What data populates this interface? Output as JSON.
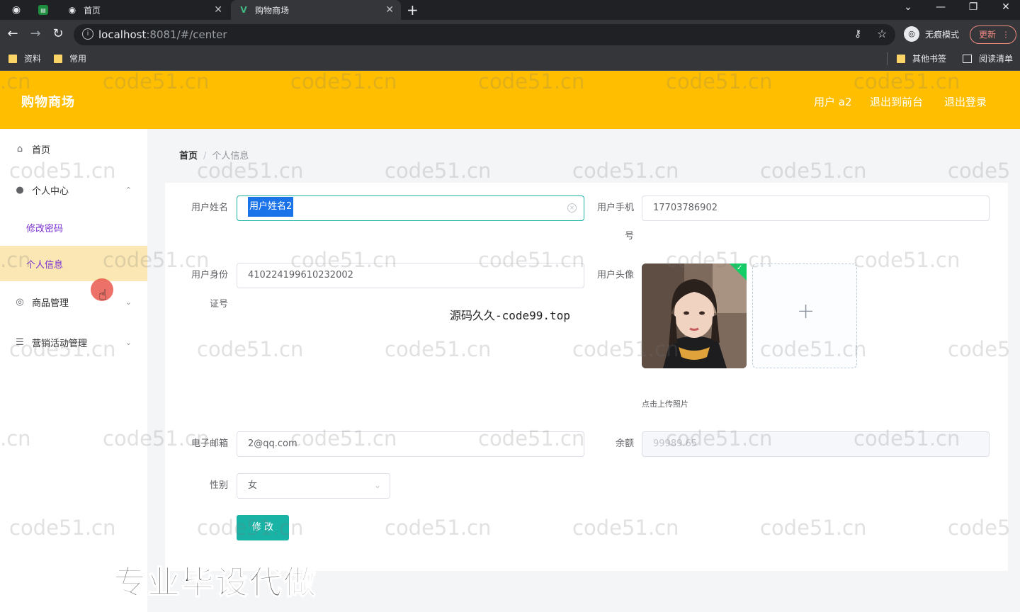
{
  "browser": {
    "tabs": [
      {
        "label": "首页"
      },
      {
        "label": "购物商场"
      }
    ],
    "url_host": "localhost",
    "url_rest": ":8081/#/center",
    "incognito_label": "无痕模式",
    "update_label": "更新",
    "bookmarks": [
      {
        "label": "资料"
      },
      {
        "label": "常用"
      },
      {
        "label": "其他书签"
      },
      {
        "label": "阅读清单"
      }
    ]
  },
  "header": {
    "title": "购物商场",
    "links": [
      {
        "label": "用户 a2"
      },
      {
        "label": "退出到前台"
      },
      {
        "label": "退出登录"
      }
    ]
  },
  "sidebar": {
    "items": [
      {
        "label": "首页",
        "icon": "home-icon"
      },
      {
        "label": "个人中心",
        "icon": "user-icon",
        "sub": [
          "修改密码",
          "个人信息"
        ]
      },
      {
        "label": "商品管理",
        "icon": "goods-icon"
      },
      {
        "label": "营销活动管理",
        "icon": "menu-icon"
      }
    ]
  },
  "breadcrumb": {
    "home": "首页",
    "current": "个人信息"
  },
  "form": {
    "name_label": "用户姓名",
    "name_value": "用户姓名2",
    "phone_label_1": "用户手机",
    "phone_label_2": "号",
    "phone_value": "17703786902",
    "idcard_label_1": "用户身份",
    "idcard_label_2": "证号",
    "idcard_value": "410224199610232002",
    "avatar_label": "用户头像",
    "upload_tip": "点击上传照片",
    "email_label": "电子邮箱",
    "email_value": "2@qq.com",
    "balance_label": "余额",
    "balance_value": "99989.65",
    "gender_label": "性别",
    "gender_value": "女",
    "submit_label": "修 改"
  },
  "overlays": {
    "watermark": "code51.cn",
    "watermark_partial_left": ".cn",
    "watermark_partial_right": "code5",
    "center_text": "源码久久-code99.top",
    "bottom_text": "专业毕设代做"
  },
  "colors": {
    "header": "#ffbf00",
    "primary": "#19b3a6",
    "active_menu_bg": "#fbe7b3"
  }
}
